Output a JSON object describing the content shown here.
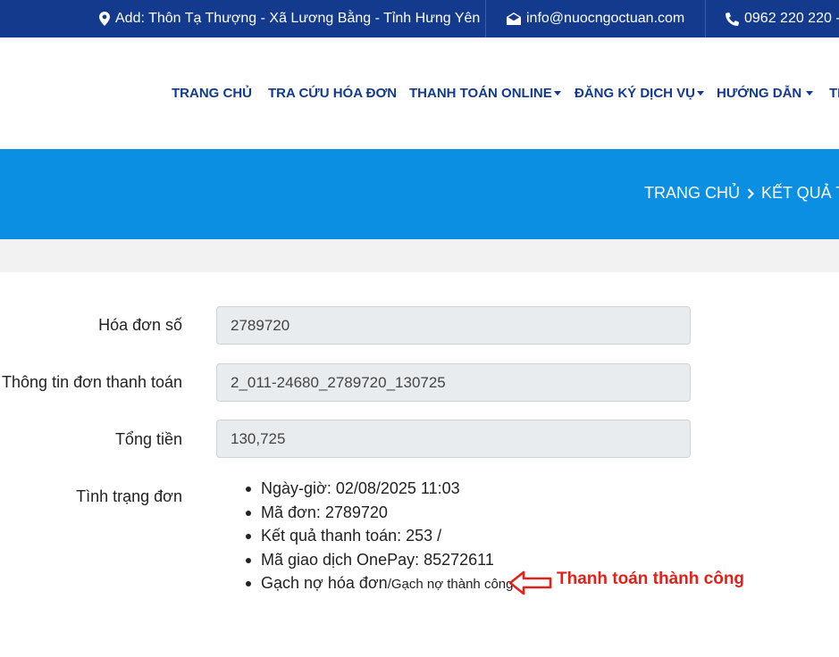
{
  "topbar": {
    "address": "Add: Thôn Tạ Thượng - Xã Lương Bằng - Tỉnh Hưng Yên",
    "email": "info@nuocngoctuan.com",
    "phone": "0962 220 220 -"
  },
  "nav": {
    "items": [
      {
        "label": "TRANG CHỦ",
        "has_dropdown": false
      },
      {
        "label": "TRA CỨU HÓA ĐƠN",
        "has_dropdown": false
      },
      {
        "label": "THANH TOÁN ONLINE",
        "has_dropdown": true
      },
      {
        "label": "ĐĂNG KÝ DỊCH VỤ",
        "has_dropdown": true
      },
      {
        "label": "HƯỚNG DẪN",
        "has_dropdown": true
      },
      {
        "label": "TI",
        "has_dropdown": false
      }
    ]
  },
  "breadcrumb": {
    "home": "TRANG CHỦ",
    "current": "KẾT QUẢ TH"
  },
  "form": {
    "invoice_label": "Hóa đơn số",
    "invoice_value": "2789720",
    "payment_info_label": "Thông tin đơn thanh toán",
    "payment_info_value": "2_011-24680_2789720_130725",
    "total_label": "Tổng tiền",
    "total_value": "130,725",
    "status_label": "Tình trạng đơn"
  },
  "status": {
    "datetime": "Ngày-giờ: 02/08/2025 11:03",
    "order_id": "Mã đơn: 2789720",
    "result": "Kết quả thanh toán: 253 /",
    "transaction": "Mã giao dịch OnePay: 85272611",
    "debit_prefix": "Gạch nợ hóa đơn",
    "debit_result": "/Gạch nợ thành công"
  },
  "annotation": {
    "text": "Thanh toán thành công",
    "color": "#e3211b"
  },
  "colors": {
    "topbar": "#133a8c",
    "nav_text": "#133a8c",
    "banner": "#0a8fe3"
  }
}
